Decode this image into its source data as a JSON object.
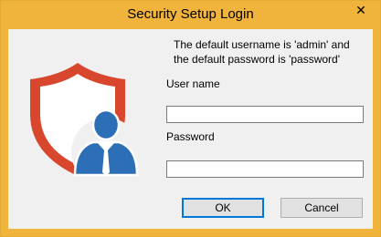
{
  "window": {
    "title": "Security Setup Login",
    "close_glyph": "✕"
  },
  "dialog": {
    "info_line1": "The default username is 'admin' and",
    "info_line2": "the default password is 'password'",
    "username_label": "User name",
    "username_value": "",
    "password_label": "Password",
    "password_value": "",
    "ok_label": "OK",
    "cancel_label": "Cancel"
  },
  "icons": {
    "logo": "shield-user-icon"
  },
  "colors": {
    "titlebar": "#f0b43c",
    "shield": "#d8462e",
    "user": "#2c6fb6"
  }
}
